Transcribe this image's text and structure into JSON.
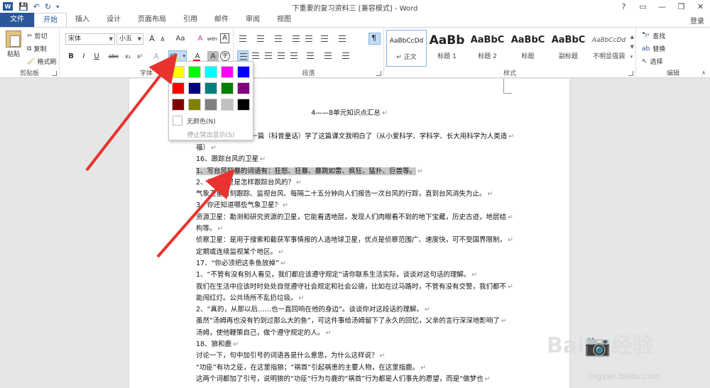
{
  "titlebar": {
    "app_icon": "W",
    "title": "下重要的复习资料三 [兼容模式] - Word",
    "window_controls": [
      "?",
      "▭",
      "—",
      "❐",
      "✕"
    ]
  },
  "tabs": {
    "file": "文件",
    "items": [
      "开始",
      "插入",
      "设计",
      "页面布局",
      "引用",
      "邮件",
      "审阅",
      "视图"
    ],
    "login": "登录"
  },
  "clipboard": {
    "paste": "粘贴",
    "cut": "剪切",
    "copy": "复制",
    "format_painter": "格式刷",
    "label": "剪贴板"
  },
  "font": {
    "name": "宋体",
    "size": "小五",
    "grow": "A",
    "shrink": "A",
    "case": "Aa",
    "clear": "A",
    "wen": "wén",
    "border_char": "A",
    "bold": "B",
    "italic": "I",
    "underline": "U",
    "strike": "abc",
    "sub": "x₂",
    "sup": "x²",
    "effects": "A",
    "highlight": "ab",
    "color": "A",
    "shade": "A",
    "circle": "字",
    "label": "字体"
  },
  "paragraph": {
    "label": "段落"
  },
  "styles": {
    "items": [
      {
        "sample": "AaBbCcDd",
        "name": "↵ 正文"
      },
      {
        "sample": "AaBb",
        "name": "标题 1"
      },
      {
        "sample": "AaBbC",
        "name": "标题 2"
      },
      {
        "sample": "AaBbC",
        "name": "标题"
      },
      {
        "sample": "AaBbC",
        "name": "副标题"
      },
      {
        "sample": "AaBbCcDd",
        "name": "不明显强调"
      }
    ],
    "label": "样式"
  },
  "editing": {
    "find": "查找",
    "replace": "替换",
    "select": "选择",
    "label": "编辑"
  },
  "highlight_menu": {
    "colors": [
      "#ffff00",
      "#00ff00",
      "#00ffff",
      "#ff00ff",
      "#0000ff",
      "#ff0000",
      "#000080",
      "#008080",
      "#008000",
      "#800080",
      "#800000",
      "#808000",
      "#808080",
      "#c0c0c0",
      "#000000"
    ],
    "no_color": "无颜色(N)",
    "stop": "停止突出显示(S)"
  },
  "document": {
    "lines": [
      {
        "text": "4——8单元知识点汇总",
        "center": true
      },
      {
        "text": "寒才对"
      },
      {
        "text": "1、《水上飞机》是一篇（科普童话）学了这篇课文我明白了（从小爱科学、学科学、长大用科学为人类造"
      },
      {
        "text": "福）"
      },
      {
        "text": "16、跟踪台风的卫星"
      },
      {
        "text": "1、写台风狂暴的词语有：狂怒、狂暴、暴跳如雷、疯狂、猛扑、巨兽等。",
        "highlight": true
      },
      {
        "text": "2、气象卫星是怎样跟踪台风的？"
      },
      {
        "text": "气象卫星时刻跟踪、监视台风、每隔二十五分钟向人们报告一次台风的行踪，直到台风消失为止。"
      },
      {
        "text": "3、你还知道哪些气象卫星？"
      },
      {
        "text": "资源卫星：勘测和研究资源的卫星，它能看透地层，发现人们肉眼看不到的地下宝藏，历史古迹，地层结"
      },
      {
        "text": "构等。"
      },
      {
        "text": "侦察卫星：是用于搜索和截获军事情报的人造地球卫星，优点是侦察范围广、速度快，可不受国界限制，"
      },
      {
        "text": "定期或连续监视某个地区。"
      },
      {
        "text": "17、“你必须把这条鱼放掉”"
      },
      {
        "text": "1、“不管有没有别人看见，我们都应该遵守规定”请你联系生活实际，谈谈对这句话的理解。"
      },
      {
        "text": "我们在生活中应该时时处处自觉遵守社会规定和社会公德，比如在过马路时，不管有没有交警，我们都不"
      },
      {
        "text": "能闯红灯。公共场所不乱扔垃圾。"
      },
      {
        "text": "2、“真的，从那以后……也一直回响在他的身边”。谈谈你对这段话的理解。"
      },
      {
        "text": "虽然“汤姆再也没有钓到过那么大的鱼”，可这件事给汤姆留下了永久的回忆，父亲的言行深深地影响了"
      },
      {
        "text": "汤姆，使他鞭策自己，做个遵守规定的人。"
      },
      {
        "text": "18、狼和鹿"
      },
      {
        "text": "讨论一下，句中加引号的词语各是什么意思，为什么这样说？"
      },
      {
        "text": "“功臣”有功之臣，在这里指狼；“祸首”引起祸患的主要人物，在这里指鹿。"
      },
      {
        "text": "这两个词都加了引号，说明狼的“功臣”行为与鹿的“祸首”行为都是人们事先的愿望，而是“做梦也"
      }
    ]
  },
  "watermark": {
    "main": "Bai📷经验",
    "sub": "jingyan.baidu.com"
  }
}
